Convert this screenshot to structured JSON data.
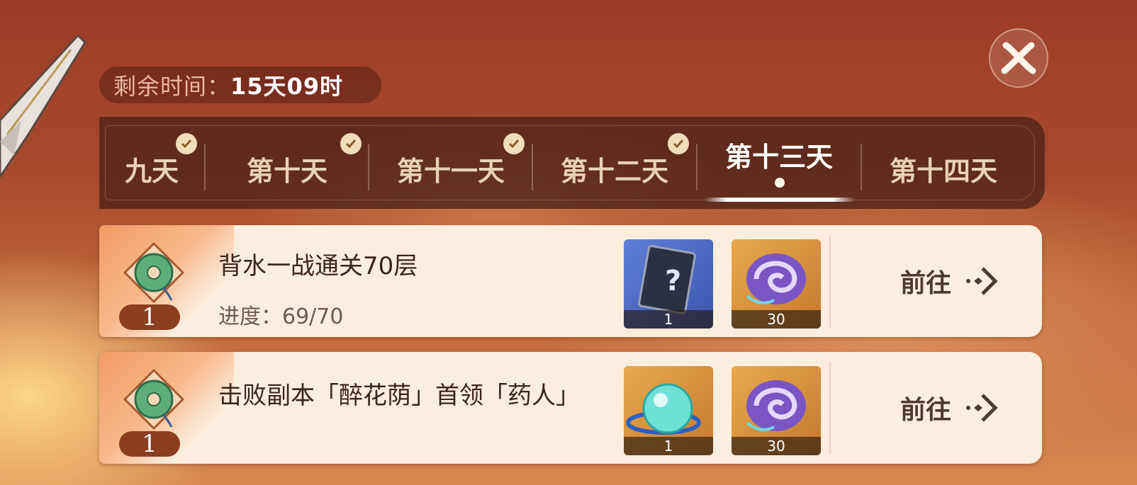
{
  "timer": {
    "label": "剩余时间：",
    "value": "15天09时"
  },
  "close_icon": "close-icon",
  "tabs": [
    {
      "label": "九天",
      "completed": true,
      "active": false
    },
    {
      "label": "第十天",
      "completed": true,
      "active": false
    },
    {
      "label": "第十一天",
      "completed": true,
      "active": false
    },
    {
      "label": "第十二天",
      "completed": true,
      "active": false
    },
    {
      "label": "第十三天",
      "completed": false,
      "active": true
    },
    {
      "label": "第十四天",
      "completed": false,
      "active": false
    }
  ],
  "tasks": [
    {
      "title": "背水一战通关70层",
      "progress": "进度：69/70",
      "points": "1",
      "rewards": [
        {
          "icon": "mystery-book-icon",
          "quantity": "1"
        },
        {
          "icon": "purple-swirl-icon",
          "quantity": "30"
        }
      ],
      "action": "前往"
    },
    {
      "title": "击败副本「醉花荫」首领「药人」",
      "progress": "",
      "points": "1",
      "rewards": [
        {
          "icon": "cyan-orb-icon",
          "quantity": "1"
        },
        {
          "icon": "purple-swirl-icon",
          "quantity": "30"
        }
      ],
      "action": "前往"
    }
  ],
  "colors": {
    "background": "#a84a2e",
    "card": "#fbeede",
    "tabbar": "#502418",
    "accent": "#f39a63",
    "points_pill": "#8c3d1f"
  }
}
